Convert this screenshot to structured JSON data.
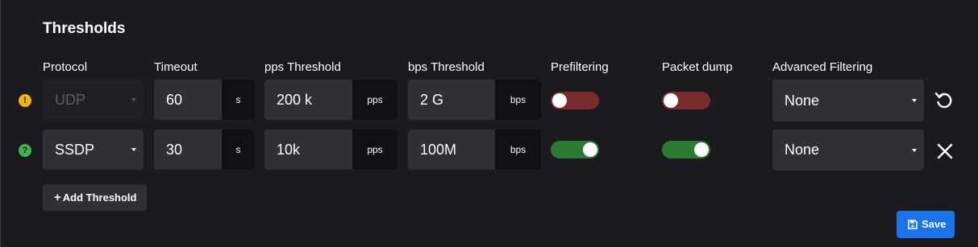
{
  "section": {
    "title": "Thresholds"
  },
  "columns": {
    "protocol": "Protocol",
    "timeout": "Timeout",
    "pps": "pps Threshold",
    "bps": "bps Threshold",
    "prefiltering": "Prefiltering",
    "packet_dump": "Packet dump",
    "advanced": "Advanced Filtering"
  },
  "rows": [
    {
      "status_icon": "warning-icon",
      "status_glyph": "!",
      "status_color": "#f2b705",
      "protocol": "UDP",
      "protocol_disabled": true,
      "timeout": "60",
      "timeout_unit": "s",
      "pps": "200 k",
      "pps_unit": "pps",
      "bps": "2 G",
      "bps_unit": "bps",
      "prefiltering": false,
      "packet_dump": false,
      "advanced": "None",
      "action_icon": "reset-icon"
    },
    {
      "status_icon": "help-icon",
      "status_glyph": "?",
      "status_color": "#3fb34f",
      "protocol": "SSDP",
      "protocol_disabled": false,
      "timeout": "30",
      "timeout_unit": "s",
      "pps": "10k",
      "pps_unit": "pps",
      "bps": "100M",
      "bps_unit": "bps",
      "prefiltering": true,
      "packet_dump": true,
      "advanced": "None",
      "action_icon": "close-icon"
    }
  ],
  "buttons": {
    "add_threshold": "Add Threshold",
    "save": "Save"
  },
  "colors": {
    "toggle_on": "#2a7a33",
    "toggle_off": "#7a2b2b",
    "save_button": "#1a73e8"
  }
}
